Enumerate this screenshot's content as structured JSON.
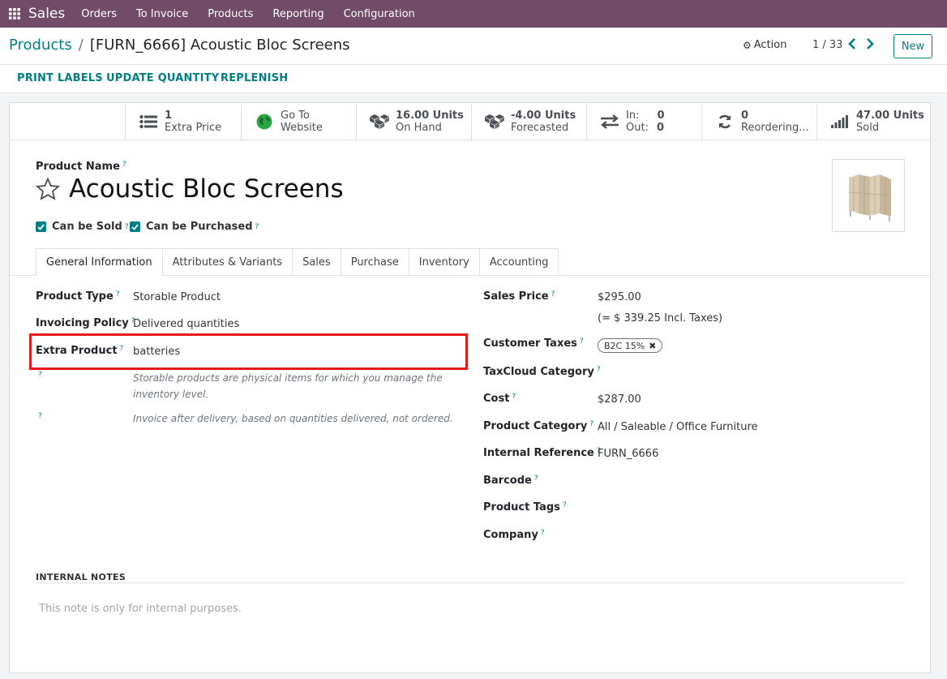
{
  "navbar": {
    "app_name": "Sales",
    "menu": [
      "Orders",
      "To Invoice",
      "Products",
      "Reporting",
      "Configuration"
    ],
    "background": "#714b67"
  },
  "breadcrumb": {
    "parent": "Products",
    "separator": "/",
    "current": "[FURN_6666] Acoustic Bloc Screens"
  },
  "control": {
    "action_label": "Action",
    "pager": "1 / 33",
    "new_label": "New"
  },
  "statusbar": {
    "buttons": [
      "PRINT LABELS",
      "UPDATE QUANTITY",
      "REPLENISH"
    ]
  },
  "smart_buttons": [
    {
      "icon": "list-icon",
      "value": "1",
      "label": "Extra Price"
    },
    {
      "icon": "globe-icon",
      "value": "Go To",
      "label": "Website"
    },
    {
      "icon": "cubes-icon",
      "value": "16.00 Units",
      "label": "On Hand"
    },
    {
      "icon": "cubes-icon",
      "value": "-4.00 Units",
      "label": "Forecasted"
    },
    {
      "icon": "exchange-icon",
      "in_label": "In:",
      "in_value": "0",
      "out_label": "Out:",
      "out_value": "0"
    },
    {
      "icon": "refresh-icon",
      "value": "0",
      "label": "Reordering..."
    },
    {
      "icon": "signal-icon",
      "value": "47.00 Units",
      "label": "Sold"
    }
  ],
  "product": {
    "name_label": "Product Name",
    "name": "Acoustic Bloc Screens",
    "can_be_sold_label": "Can be Sold",
    "can_be_purchased_label": "Can be Purchased",
    "help_mark": "?"
  },
  "tabs": [
    "General Information",
    "Attributes & Variants",
    "Sales",
    "Purchase",
    "Inventory",
    "Accounting"
  ],
  "left_fields": {
    "product_type_label": "Product Type",
    "product_type": "Storable Product",
    "invoicing_policy_label": "Invoicing Policy",
    "invoicing_policy": "Delivered quantities",
    "extra_product_label": "Extra Product",
    "extra_product": "batteries",
    "help_type_1": "Storable products are physical items for which you manage the",
    "help_type_2": "inventory level.",
    "help_invoice": "Invoice after delivery, based on quantities delivered, not ordered."
  },
  "right_fields": {
    "sales_price_label": "Sales Price",
    "sales_price": "$295.00",
    "incl_taxes": "(= $ 339.25 Incl. Taxes)",
    "customer_taxes_label": "Customer Taxes",
    "customer_tax_badge": "B2C 15%",
    "taxcloud_label": "TaxCloud Category",
    "cost_label": "Cost",
    "cost": "$287.00",
    "category_label": "Product Category",
    "category": "All / Saleable / Office Furniture",
    "internal_ref_label": "Internal Reference",
    "internal_ref": "FURN_6666",
    "barcode_label": "Barcode",
    "tags_label": "Product Tags",
    "company_label": "Company"
  },
  "notes": {
    "title": "INTERNAL NOTES",
    "placeholder": "This note is only for internal purposes."
  },
  "colors": {
    "accent": "#017e84",
    "brand": "#714b67",
    "highlight": "#e81818"
  }
}
